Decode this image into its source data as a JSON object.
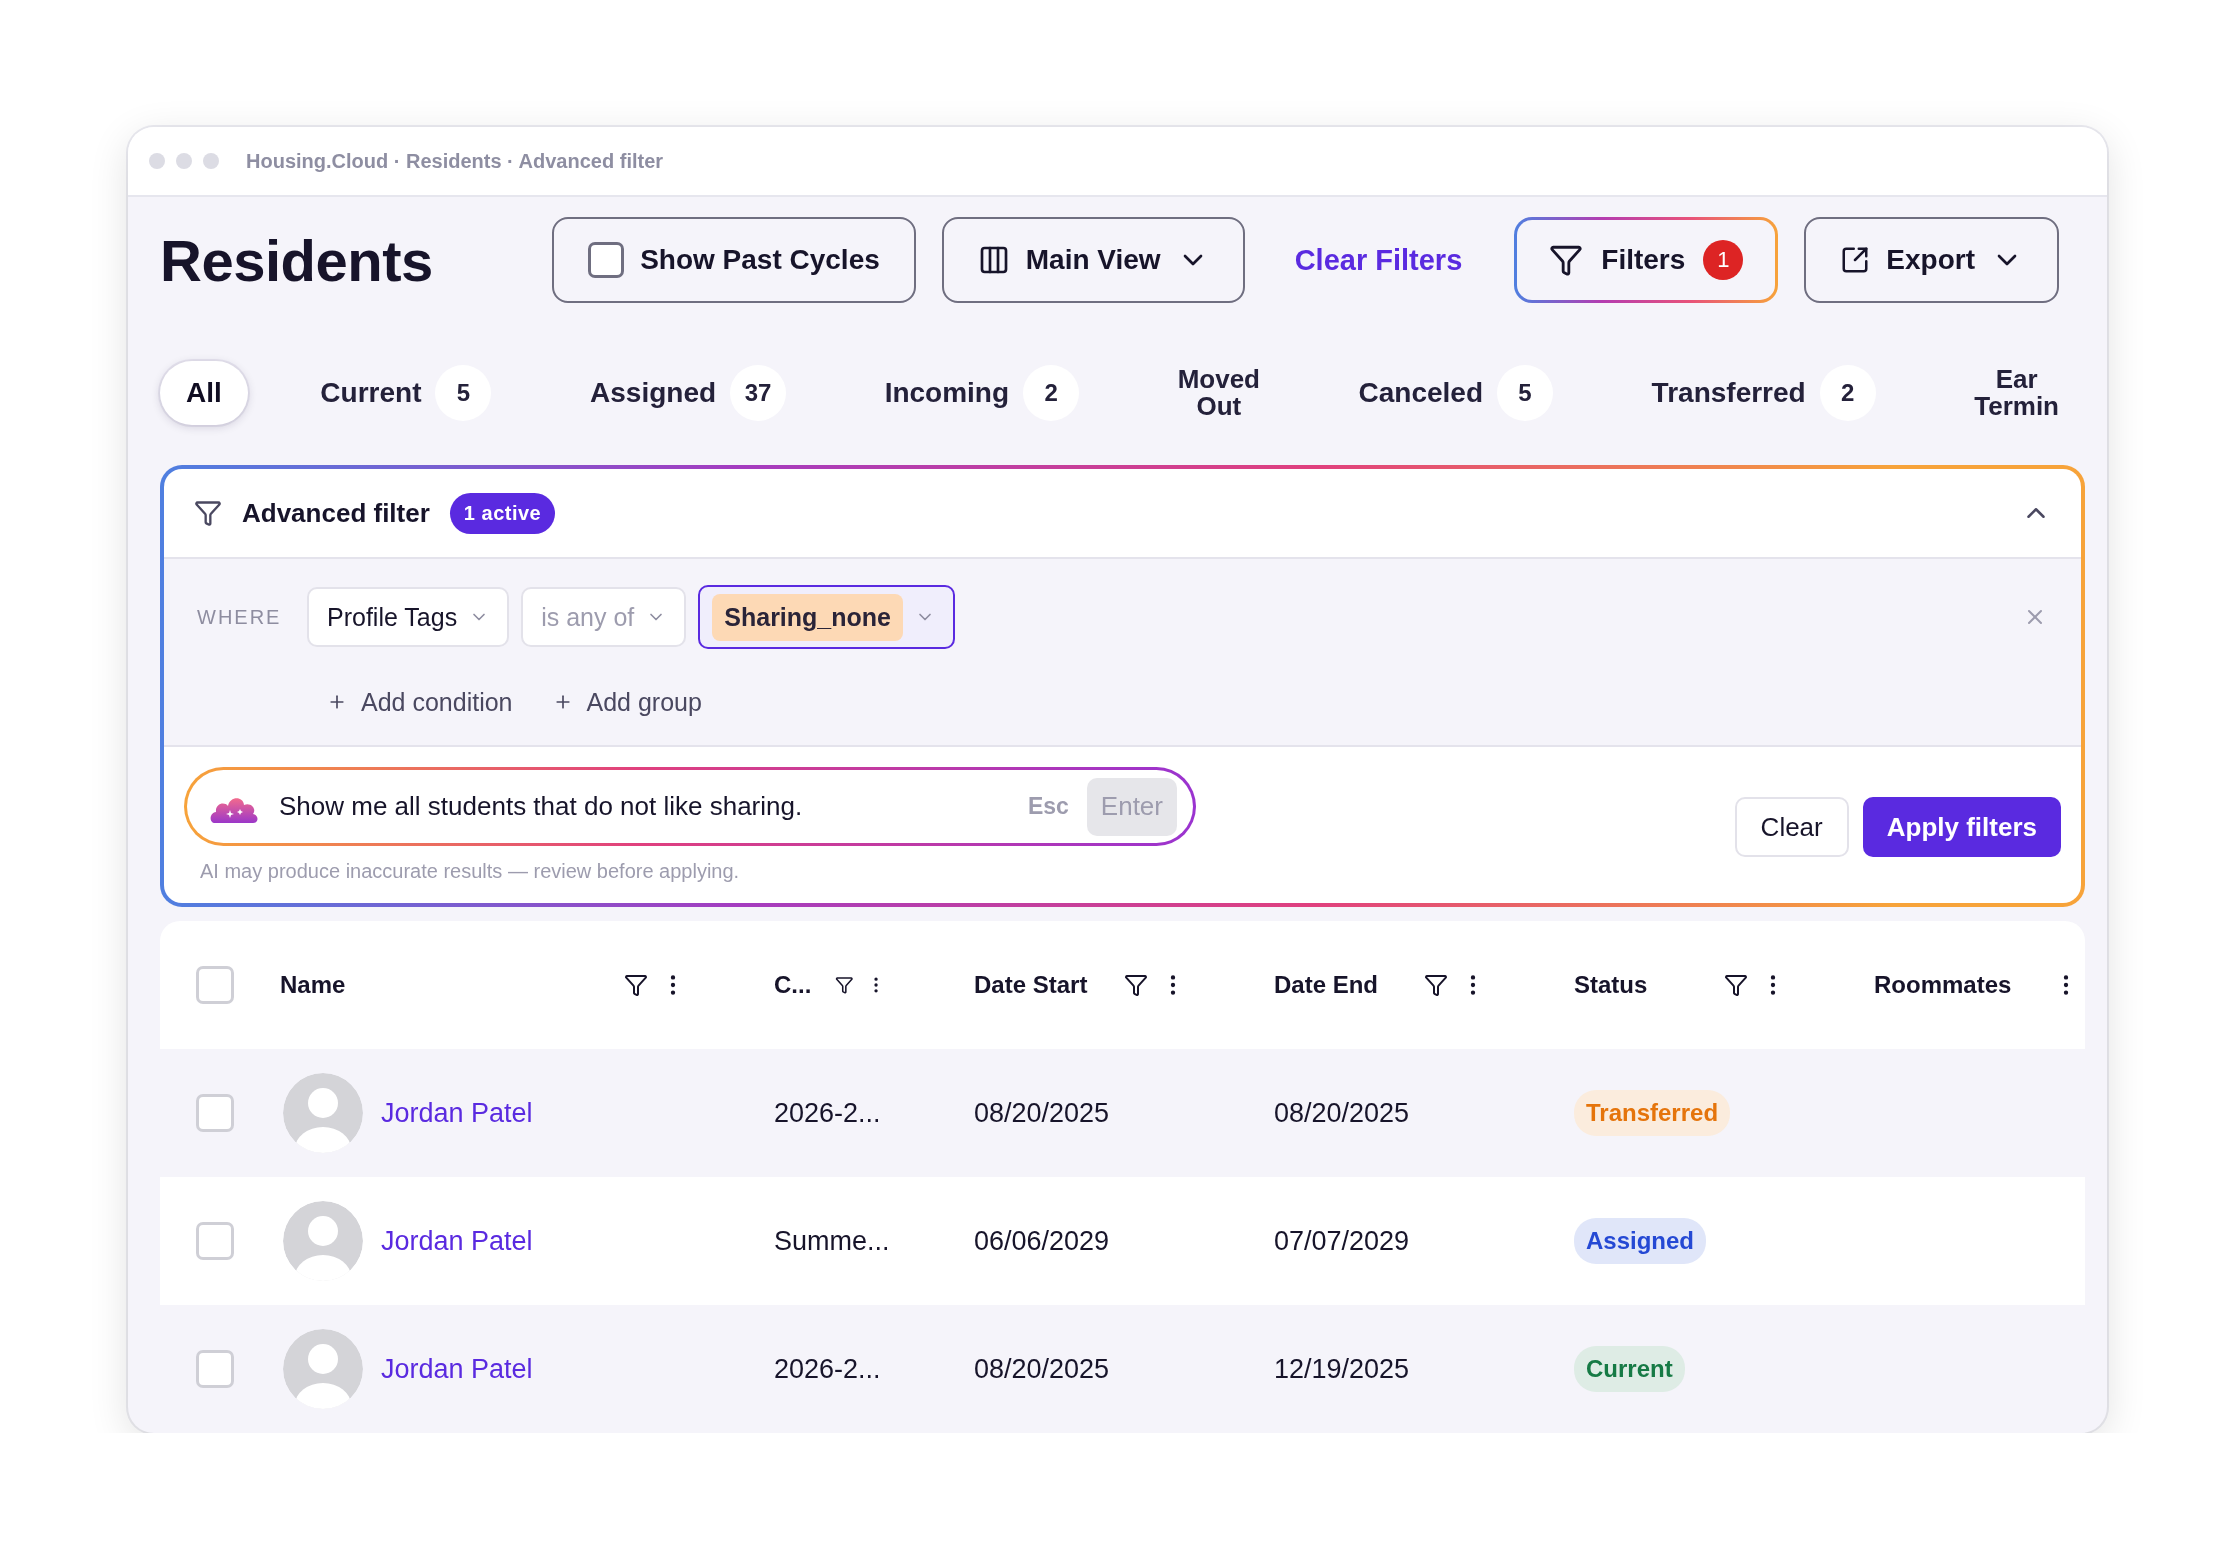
{
  "window": {
    "title": "Housing.Cloud · Residents · Advanced filter"
  },
  "page_title": "Residents",
  "toolbar": {
    "show_past_cycles": {
      "label": "Show Past Cycles",
      "checked": false
    },
    "view": {
      "label": "Main View"
    },
    "clear_filters": "Clear Filters",
    "filters": {
      "label": "Filters",
      "badge": "1"
    },
    "export": {
      "label": "Export"
    }
  },
  "tabs": [
    {
      "label": "All",
      "selected": true
    },
    {
      "label": "Current",
      "count": "5",
      "selected": false
    },
    {
      "label": "Assigned",
      "count": "37",
      "selected": false
    },
    {
      "label": "Incoming",
      "count": "2",
      "selected": false
    },
    {
      "label": "Moved Out",
      "selected": false
    },
    {
      "label": "Canceled",
      "count": "5",
      "selected": false
    },
    {
      "label": "Transferred",
      "count": "2",
      "selected": false
    },
    {
      "label": "Ear Termin",
      "selected": false
    }
  ],
  "advanced_filter": {
    "title": "Advanced filter",
    "badge": "1 active",
    "expanded": true,
    "condition": {
      "prefix": "WHERE",
      "field": "Profile Tags",
      "operator": "is any of",
      "values": [
        "Sharing_none"
      ]
    },
    "add_condition": "Add condition",
    "add_group": "Add group",
    "ai_prompt": {
      "value": "Show me all students that do not like sharing.",
      "esc": "Esc",
      "enter": "Enter"
    },
    "disclaimer": "AI may produce inaccurate results — review before applying.",
    "clear": "Clear",
    "apply": "Apply filters"
  },
  "table": {
    "all_selected": false,
    "columns": [
      {
        "label": "Name",
        "filter": true
      },
      {
        "label": "C...",
        "filter": true
      },
      {
        "label": "Date Start",
        "filter": true
      },
      {
        "label": "Date End",
        "filter": true
      },
      {
        "label": "Status",
        "filter": true
      },
      {
        "label": "Roommates",
        "filter": false
      }
    ],
    "rows": [
      {
        "selected": false,
        "name": "Jordan Patel",
        "cycle": "2026-2...",
        "date_start": "08/20/2025",
        "date_end": "08/20/2025",
        "status": {
          "label": "Transferred",
          "color": "#e5740b"
        }
      },
      {
        "selected": false,
        "name": "Jordan Patel",
        "cycle": "Summe...",
        "date_start": "06/06/2029",
        "date_end": "07/07/2029",
        "status": {
          "label": "Assigned",
          "color": "#2549d4"
        }
      },
      {
        "selected": false,
        "name": "Jordan Patel",
        "cycle": "2026-2...",
        "date_start": "08/20/2025",
        "date_end": "12/19/2025",
        "status": {
          "label": "Current",
          "color": "#167a45"
        }
      }
    ]
  }
}
